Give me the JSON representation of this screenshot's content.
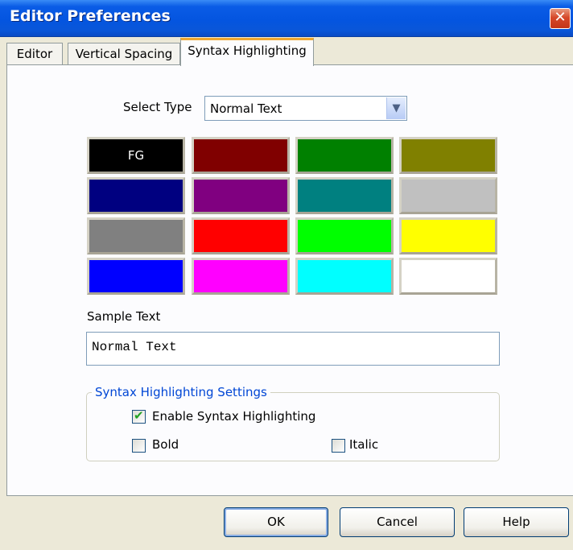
{
  "window": {
    "title": "Editor Preferences",
    "close_glyph": "✕"
  },
  "tabs": [
    {
      "label": "Editor",
      "active": false
    },
    {
      "label": "Vertical Spacing",
      "active": false
    },
    {
      "label": "Syntax Highlighting",
      "active": true
    }
  ],
  "select_type": {
    "label": "Select Type",
    "value": "Normal Text",
    "arrow_icon": "chevron-down-icon"
  },
  "palette": {
    "fg_label": "FG",
    "colors": [
      "#000000",
      "#800000",
      "#008000",
      "#808000",
      "#000080",
      "#800080",
      "#008080",
      "#c0c0c0",
      "#808080",
      "#ff0000",
      "#00ff00",
      "#ffff00",
      "#0000ff",
      "#ff00ff",
      "#00ffff",
      "#ffffff"
    ]
  },
  "sample": {
    "label": "Sample Text",
    "value": "Normal Text"
  },
  "settings": {
    "legend": "Syntax Highlighting Settings",
    "enable": {
      "label": "Enable Syntax Highlighting",
      "checked": true
    },
    "bold": {
      "label": "Bold",
      "checked": false
    },
    "italic": {
      "label": "Italic",
      "checked": false
    }
  },
  "buttons": {
    "ok": "OK",
    "cancel": "Cancel",
    "help": "Help"
  },
  "colors": {
    "titlebar": "#0455e0",
    "accent": "#0046d5",
    "active_tab_highlight": "#f0a830"
  }
}
